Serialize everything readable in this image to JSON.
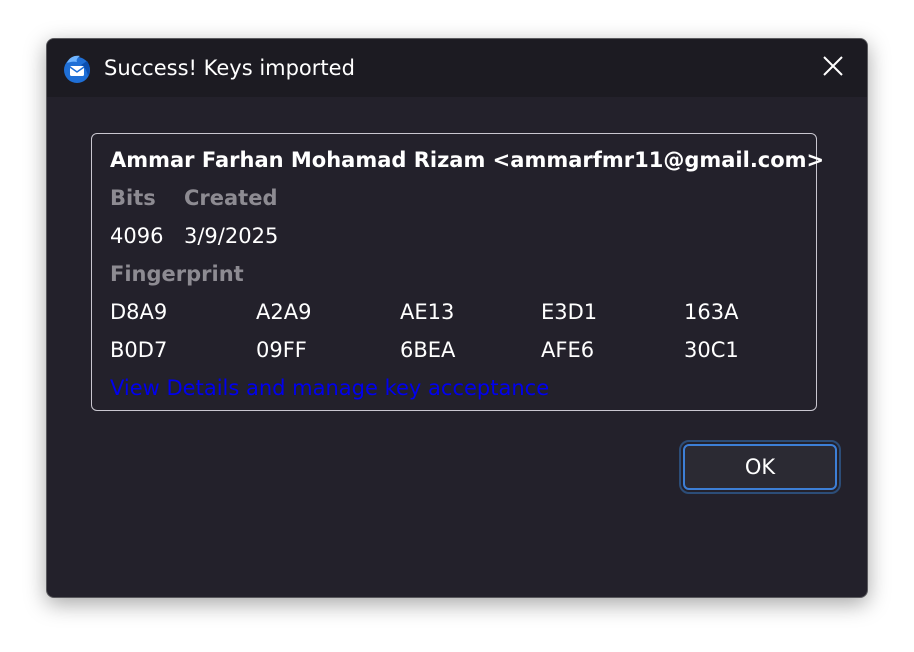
{
  "dialog": {
    "title": "Success! Keys imported",
    "app_icon": "thunderbird-icon",
    "close_icon": "close-icon"
  },
  "key": {
    "identity": "Ammar Farhan Mohamad Rizam <ammarfmr11@gmail.com>",
    "bits_label": "Bits",
    "created_label": "Created",
    "bits_value": "4096",
    "created_value": "3/9/2025",
    "fingerprint_label": "Fingerprint",
    "fingerprint": [
      [
        "D8A9",
        "A2A9",
        "AE13",
        "E3D1",
        "163A"
      ],
      [
        "B0D7",
        "09FF",
        "6BEA",
        "AFE6",
        "30C1"
      ]
    ],
    "details_link": "View Details and manage key acceptance"
  },
  "buttons": {
    "ok_label": "OK"
  },
  "colors": {
    "window_bg": "#23212b",
    "titlebar_bg": "#1c1b22",
    "link": "#0000ee",
    "focus_ring": "#3d7fd6"
  }
}
